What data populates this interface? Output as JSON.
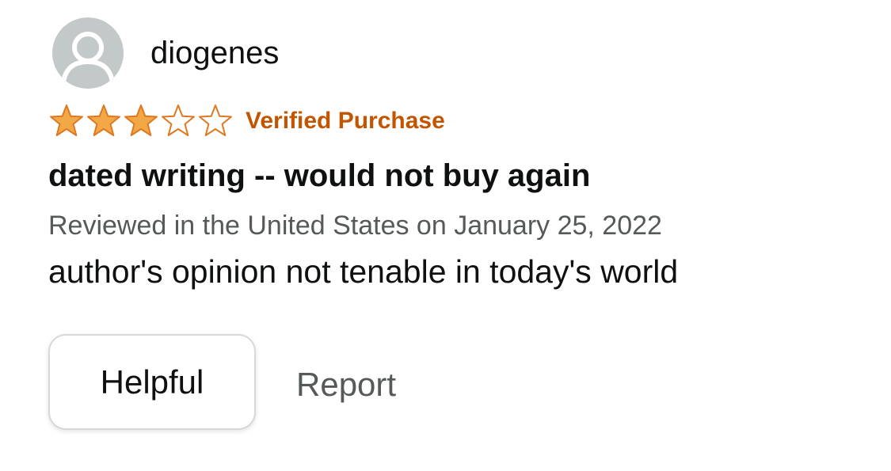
{
  "review": {
    "reviewer_name": "diogenes",
    "rating": 3,
    "max_rating": 5,
    "verified_label": "Verified Purchase",
    "title": "dated writing -- would not buy again",
    "meta": "Reviewed in the United States on January 25, 2022",
    "body": "author's opinion not tenable in today's world",
    "helpful_label": "Helpful",
    "report_label": "Report"
  },
  "colors": {
    "star_fill": "#f3a847",
    "star_stroke": "#de7921",
    "verified": "#c45500",
    "avatar_bg": "#c3c8c9",
    "muted_text": "#565959"
  }
}
